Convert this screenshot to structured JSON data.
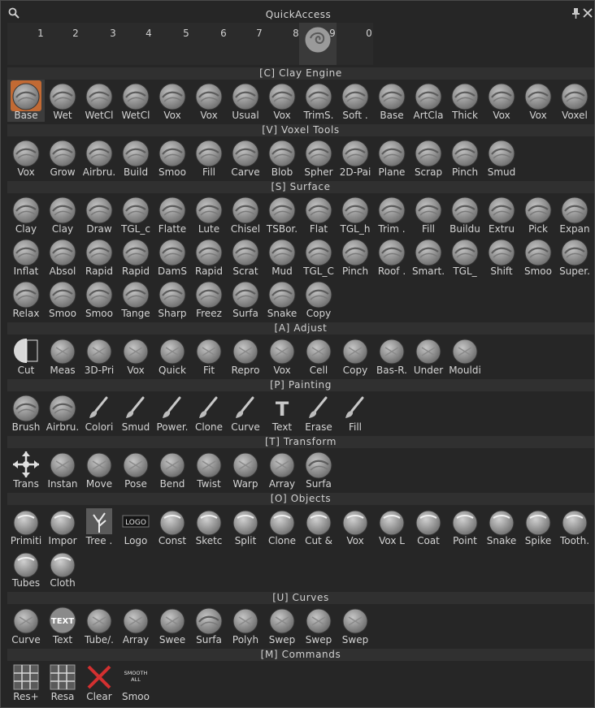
{
  "window": {
    "title": "QuickAccess"
  },
  "slots": {
    "numbers": [
      "1",
      "2",
      "3",
      "4",
      "5",
      "6",
      "7",
      "8",
      "9",
      "0"
    ],
    "occupied_index": 8
  },
  "sections": [
    {
      "id": "clay",
      "title": "[C]  Clay  Engine",
      "items": [
        {
          "label": "Base",
          "icon": "clay-brush-icon",
          "selected": true
        },
        {
          "label": "Wet",
          "icon": "wet-brush-icon"
        },
        {
          "label": "WetCl",
          "icon": "wetclay-brush-icon"
        },
        {
          "label": "WetCl",
          "icon": "wetclay-brush-icon"
        },
        {
          "label": "Vox",
          "icon": "voxel-brush-icon"
        },
        {
          "label": "Vox",
          "icon": "voxel-brush-icon"
        },
        {
          "label": "Usual",
          "icon": "clay-brush-icon"
        },
        {
          "label": "Vox",
          "icon": "voxel-brush-icon"
        },
        {
          "label": "TrimS.",
          "icon": "trim-brush-icon"
        },
        {
          "label": "Soft .",
          "icon": "soft-brush-icon"
        },
        {
          "label": "Base",
          "icon": "clay-brush-icon"
        },
        {
          "label": "ArtCla",
          "icon": "artclay-brush-icon"
        },
        {
          "label": "Thick",
          "icon": "thick-brush-icon"
        },
        {
          "label": "Vox",
          "icon": "voxel-brush-icon"
        },
        {
          "label": "Vox",
          "icon": "voxel-brush-icon"
        },
        {
          "label": "Voxel",
          "icon": "voxel-brush-icon"
        }
      ]
    },
    {
      "id": "voxel",
      "title": "[V]  Voxel  Tools",
      "items": [
        {
          "label": "Vox",
          "icon": "voxel-tool-icon"
        },
        {
          "label": "Grow",
          "icon": "grow-tool-icon"
        },
        {
          "label": "Airbru.",
          "icon": "airbrush-tool-icon"
        },
        {
          "label": "Build",
          "icon": "build-tool-icon"
        },
        {
          "label": "Smoo",
          "icon": "smooth-tool-icon"
        },
        {
          "label": "Fill",
          "icon": "fill-tool-icon"
        },
        {
          "label": "Carve",
          "icon": "carve-tool-icon"
        },
        {
          "label": "Blob",
          "icon": "blob-tool-icon"
        },
        {
          "label": "Spher",
          "icon": "sphere-tool-icon"
        },
        {
          "label": "2D-Pai",
          "icon": "paint-2d-tool-icon"
        },
        {
          "label": "Plane",
          "icon": "plane-tool-icon"
        },
        {
          "label": "Scrap",
          "icon": "scrape-tool-icon"
        },
        {
          "label": "Pinch",
          "icon": "pinch-tool-icon"
        },
        {
          "label": "Smud",
          "icon": "smudge-tool-icon"
        }
      ]
    },
    {
      "id": "surface",
      "title": "[S]  Surface",
      "items": [
        {
          "label": "Clay",
          "icon": "clay-surface-icon"
        },
        {
          "label": "Clay",
          "icon": "clay-surface-icon"
        },
        {
          "label": "Draw",
          "icon": "draw-surface-icon"
        },
        {
          "label": "TGL_c",
          "icon": "tgl-surface-icon"
        },
        {
          "label": "Flatte",
          "icon": "flatten-surface-icon"
        },
        {
          "label": "Lute",
          "icon": "lute-surface-icon"
        },
        {
          "label": "Chisel",
          "icon": "chisel-surface-icon"
        },
        {
          "label": "TSBor.",
          "icon": "tsborder-surface-icon"
        },
        {
          "label": "Flat",
          "icon": "flat-surface-icon"
        },
        {
          "label": "TGL_h",
          "icon": "tgl-surface-icon"
        },
        {
          "label": "Trim .",
          "icon": "trim-surface-icon"
        },
        {
          "label": "Fill",
          "icon": "fill-surface-icon"
        },
        {
          "label": "Buildu",
          "icon": "buildup-surface-icon"
        },
        {
          "label": "Extru",
          "icon": "extrude-surface-icon"
        },
        {
          "label": "Pick",
          "icon": "pick-surface-icon"
        },
        {
          "label": "Expan",
          "icon": "expand-surface-icon"
        },
        {
          "label": "Inflat",
          "icon": "inflate-surface-icon"
        },
        {
          "label": "Absol",
          "icon": "absolute-surface-icon"
        },
        {
          "label": "Rapid",
          "icon": "rapid-surface-icon"
        },
        {
          "label": "Rapid",
          "icon": "rapid-surface-icon"
        },
        {
          "label": "DamS",
          "icon": "damstandard-surface-icon"
        },
        {
          "label": "Rapid",
          "icon": "rapid-surface-icon"
        },
        {
          "label": "Scrat",
          "icon": "scratch-surface-icon"
        },
        {
          "label": "Mud",
          "icon": "mud-surface-icon"
        },
        {
          "label": "TGL_C",
          "icon": "tgl-surface-icon"
        },
        {
          "label": "Pinch",
          "icon": "pinch-surface-icon"
        },
        {
          "label": "Roof .",
          "icon": "roof-surface-icon"
        },
        {
          "label": "Smart.",
          "icon": "smart-surface-icon"
        },
        {
          "label": "TGL_",
          "icon": "tgl-surface-icon"
        },
        {
          "label": "Shift",
          "icon": "shift-surface-icon"
        },
        {
          "label": "Smoo",
          "icon": "smooth-surface-icon"
        },
        {
          "label": "Super.",
          "icon": "super-surface-icon"
        },
        {
          "label": "Relax",
          "icon": "relax-surface-icon"
        },
        {
          "label": "Smoo",
          "icon": "smooth-surface-icon"
        },
        {
          "label": "Smoo",
          "icon": "smooth-surface-icon"
        },
        {
          "label": "Tange",
          "icon": "tangent-surface-icon"
        },
        {
          "label": "Sharp",
          "icon": "sharp-surface-icon"
        },
        {
          "label": "Freez",
          "icon": "freeze-surface-icon"
        },
        {
          "label": "Surfa",
          "icon": "surface-tool-icon"
        },
        {
          "label": "Snake",
          "icon": "snake-surface-icon"
        },
        {
          "label": "Copy",
          "icon": "copy-surface-icon"
        }
      ]
    },
    {
      "id": "adjust",
      "title": "[A]  Adjust",
      "items": [
        {
          "label": "Cut",
          "icon": "cut-icon"
        },
        {
          "label": "Meas",
          "icon": "measure-icon"
        },
        {
          "label": "3D-Pri",
          "icon": "print-3d-icon"
        },
        {
          "label": "Vox",
          "icon": "voxel-adjust-icon"
        },
        {
          "label": "Quick",
          "icon": "quick-icon"
        },
        {
          "label": "Fit",
          "icon": "fit-icon"
        },
        {
          "label": "Repro",
          "icon": "reproject-icon"
        },
        {
          "label": "Vox",
          "icon": "voxel-adjust-icon"
        },
        {
          "label": "Cell",
          "icon": "cell-icon"
        },
        {
          "label": "Copy",
          "icon": "copy-icon"
        },
        {
          "label": "Bas-R.",
          "icon": "bas-relief-icon"
        },
        {
          "label": "Under",
          "icon": "undercut-icon"
        },
        {
          "label": "Mouldi",
          "icon": "moulding-icon"
        }
      ]
    },
    {
      "id": "painting",
      "title": "[P]  Painting",
      "items": [
        {
          "label": "Brush",
          "icon": "paint-brush-icon"
        },
        {
          "label": "Airbru.",
          "icon": "airbrush-icon"
        },
        {
          "label": "Colori",
          "icon": "colorize-icon"
        },
        {
          "label": "Smud",
          "icon": "smudge-icon"
        },
        {
          "label": "Power.",
          "icon": "power-icon"
        },
        {
          "label": "Clone",
          "icon": "clone-stamp-icon"
        },
        {
          "label": "Curve",
          "icon": "curve-paint-icon"
        },
        {
          "label": "Text",
          "icon": "text-tool-icon"
        },
        {
          "label": "Erase",
          "icon": "eraser-icon"
        },
        {
          "label": "Fill",
          "icon": "paint-bucket-icon"
        }
      ]
    },
    {
      "id": "transform",
      "title": "[T]  Transform",
      "items": [
        {
          "label": "Trans",
          "icon": "move-arrows-icon"
        },
        {
          "label": "Instan",
          "icon": "instance-icon"
        },
        {
          "label": "Move",
          "icon": "move-icon"
        },
        {
          "label": "Pose",
          "icon": "pose-icon"
        },
        {
          "label": "Bend",
          "icon": "bend-icon"
        },
        {
          "label": "Twist",
          "icon": "twist-icon"
        },
        {
          "label": "Warp",
          "icon": "warp-icon"
        },
        {
          "label": "Array",
          "icon": "array-icon"
        },
        {
          "label": "Surfa",
          "icon": "surface-transform-icon"
        }
      ]
    },
    {
      "id": "objects",
      "title": "[O]  Objects",
      "items": [
        {
          "label": "Primiti",
          "icon": "primitives-icon"
        },
        {
          "label": "Impor",
          "icon": "import-icon"
        },
        {
          "label": "Tree .",
          "icon": "tree-icon"
        },
        {
          "label": "Logo",
          "icon": "logo-icon",
          "badge": "LOGO"
        },
        {
          "label": "Const",
          "icon": "constructor-icon"
        },
        {
          "label": "Sketc",
          "icon": "sketch-icon"
        },
        {
          "label": "Split",
          "icon": "split-icon"
        },
        {
          "label": "Clone",
          "icon": "clone-object-icon"
        },
        {
          "label": "Cut &",
          "icon": "cut-and-clone-icon"
        },
        {
          "label": "Vox",
          "icon": "voxel-object-icon"
        },
        {
          "label": "Vox L",
          "icon": "voxel-layer-icon"
        },
        {
          "label": "Coat",
          "icon": "coat-icon"
        },
        {
          "label": "Point",
          "icon": "point-icon"
        },
        {
          "label": "Snake",
          "icon": "snake-object-icon"
        },
        {
          "label": "Spike",
          "icon": "spike-icon"
        },
        {
          "label": "Tooth.",
          "icon": "toothpaste-icon"
        },
        {
          "label": "Tubes",
          "icon": "tubes-icon"
        },
        {
          "label": "Cloth",
          "icon": "cloth-icon"
        }
      ]
    },
    {
      "id": "curves",
      "title": "[U]  Curves",
      "items": [
        {
          "label": "Curve",
          "icon": "curve-icon"
        },
        {
          "label": "Text",
          "icon": "text-curve-icon",
          "badge": "TEXT"
        },
        {
          "label": "Tube/.",
          "icon": "tube-curve-icon"
        },
        {
          "label": "Array",
          "icon": "array-curve-icon"
        },
        {
          "label": "Swee",
          "icon": "sweep-icon"
        },
        {
          "label": "Surfa",
          "icon": "surface-curve-icon"
        },
        {
          "label": "Polyh",
          "icon": "polyhedron-icon"
        },
        {
          "label": "Swep",
          "icon": "sweep-fish-icon"
        },
        {
          "label": "Swep",
          "icon": "sweep-house-icon"
        },
        {
          "label": "Swep",
          "icon": "sweep-swan-icon"
        }
      ]
    },
    {
      "id": "commands",
      "title": "[M]  Commands",
      "items": [
        {
          "label": "Res+",
          "icon": "resolution-up-icon"
        },
        {
          "label": "Resa",
          "icon": "resample-icon"
        },
        {
          "label": "Clear",
          "icon": "clear-x-icon"
        },
        {
          "label": "Smoo",
          "icon": "smooth-all-icon",
          "badge": "SMOOTH ALL"
        }
      ]
    }
  ]
}
